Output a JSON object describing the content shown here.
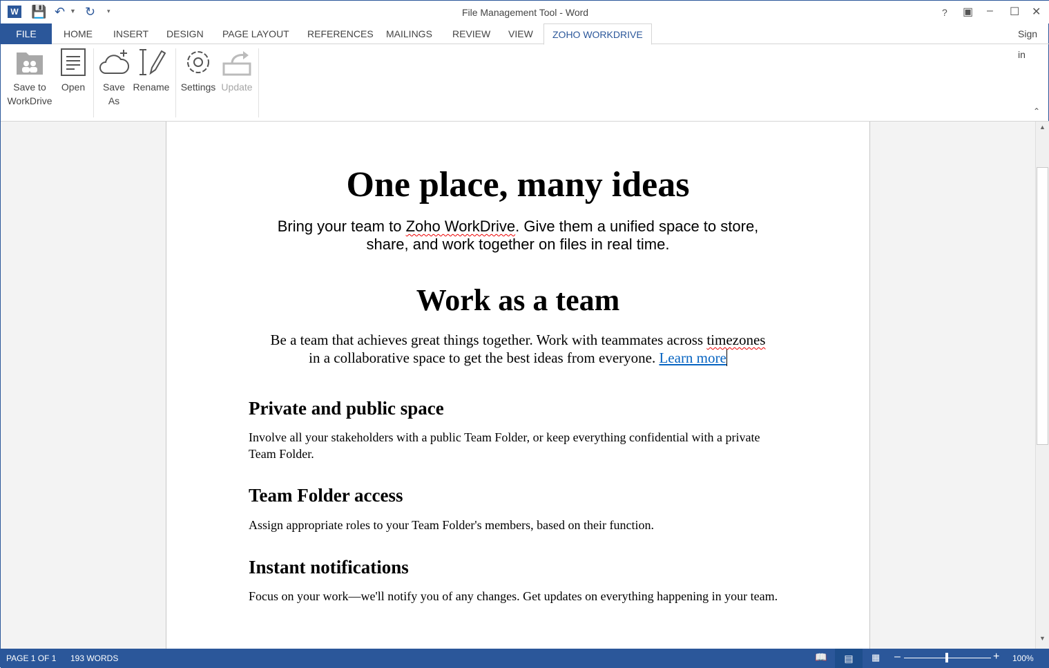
{
  "window": {
    "title": "File Management Tool - Word",
    "help": "?",
    "sign_in": "Sign in"
  },
  "tabs": [
    "FILE",
    "HOME",
    "INSERT",
    "DESIGN",
    "PAGE LAYOUT",
    "REFERENCES",
    "MAILINGS",
    "REVIEW",
    "VIEW",
    "ZOHO WORKDRIVE"
  ],
  "ribbon": {
    "save_to_1": "Save to",
    "save_to_2": "WorkDrive",
    "open": "Open",
    "save_as_1": "Save",
    "save_as_2": "As",
    "rename": "Rename",
    "settings": "Settings",
    "update": "Update"
  },
  "doc": {
    "h1": "One place, many ideas",
    "intro_1a": "Bring your team to ",
    "intro_1b": "Zoho WorkDrive",
    "intro_1c": ". Give them a unified space to store,",
    "intro_2": "share, and work together on files in real time.",
    "h2": "Work as a team",
    "p1a": "Be a team that achieves great things together. Work with teammates across ",
    "p1b": "timezones",
    "p2a": "in a collaborative space to get the best ideas from everyone. ",
    "link": "Learn more",
    "s1_title": "Private and public space",
    "s1_body": "Involve all your stakeholders with a public Team Folder, or keep everything confidential with a private Team Folder.",
    "s2_title": "Team Folder access",
    "s2_body": "Assign appropriate roles to your Team Folder's members, based on their function.",
    "s3_title": "Instant notifications",
    "s3_body": "Focus on your work—we'll notify you of any changes. Get updates on everything happening in your team."
  },
  "status": {
    "page": "PAGE 1 OF 1",
    "words": "193 WORDS",
    "zoom": "100%",
    "zoom_level": 100
  },
  "colors": {
    "accent": "#2b579a",
    "link": "#0563c1"
  }
}
